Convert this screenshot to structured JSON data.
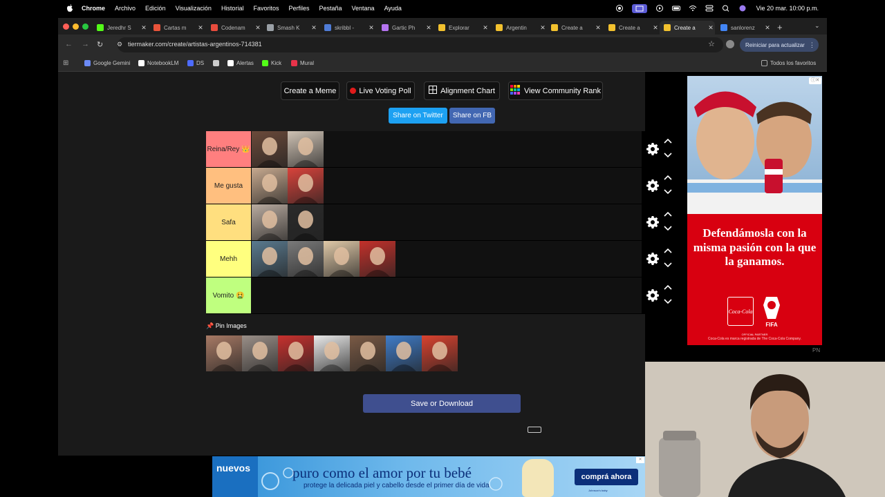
{
  "menubar": {
    "app_name": "Chrome",
    "items": [
      "Archivo",
      "Edición",
      "Visualización",
      "Historial",
      "Favoritos",
      "Perfiles",
      "Pestaña",
      "Ventana",
      "Ayuda"
    ],
    "clock": "Vie 20 mar.  10:00 p.m."
  },
  "tabs": [
    {
      "label": "Jeredhr S",
      "color": "#53fc18"
    },
    {
      "label": "Cartas m",
      "color": "#e8533a"
    },
    {
      "label": "Codenam",
      "color": "#e84c3d"
    },
    {
      "label": "Smash K",
      "color": "#9aa0a6"
    },
    {
      "label": "skribbl -",
      "color": "#4f7cd6"
    },
    {
      "label": "Gartic Ph",
      "color": "#b574f0"
    },
    {
      "label": "Explorar",
      "color": "#f2c12e"
    },
    {
      "label": "Argentin",
      "color": "#f2c12e"
    },
    {
      "label": "Create a",
      "color": "#f2c12e"
    },
    {
      "label": "Create a",
      "color": "#f2c12e"
    },
    {
      "label": "Create a",
      "color": "#f2c12e",
      "active": true
    },
    {
      "label": "sanlorenz",
      "color": "#4285f4"
    }
  ],
  "toolbar": {
    "url": "tiermaker.com/create/artistas-argentinos-714381",
    "relaunch": "Reiniciar para actualizar"
  },
  "bookmarks": {
    "items": [
      {
        "label": "Google Gemini",
        "color": "#6b8af5"
      },
      {
        "label": "NotebookLM",
        "color": "#ffffff"
      },
      {
        "label": "DS",
        "color": "#4d6bfe"
      },
      {
        "label": "",
        "color": "#cccccc"
      },
      {
        "label": "Alertas",
        "color": "#ffffff"
      },
      {
        "label": "Kick",
        "color": "#53fc18"
      },
      {
        "label": "Mural",
        "color": "#e8334a"
      }
    ],
    "all_favorites": "Todos los favoritos"
  },
  "buttons": {
    "create_meme": "Create a Meme",
    "live_poll": "Live Voting Poll",
    "alignment": "Alignment Chart",
    "community": "View Community Rank",
    "share_twitter": "Share on Twitter",
    "share_fb": "Share on FB",
    "save": "Save or Download"
  },
  "tiers": [
    {
      "label": "Reina/Rey 👑",
      "color": "#ff7f7f",
      "thumbs": [
        "#6b4a3a",
        "#cfc2b4"
      ]
    },
    {
      "label": "Me gusta",
      "color": "#ffbf7f",
      "thumbs": [
        "#c7a98f",
        "#d9433b"
      ]
    },
    {
      "label": "Safa",
      "color": "#ffdf7f",
      "thumbs": [
        "#b9aba0",
        "#2a2a2a"
      ]
    },
    {
      "label": "Mehh",
      "color": "#ffff7f",
      "thumbs": [
        "#5a7a8f",
        "#7a7a7a",
        "#e0c9a8",
        "#c3312b"
      ]
    },
    {
      "label": "Vomito 🤮",
      "color": "#bfff7f",
      "thumbs": []
    }
  ],
  "pin": {
    "label": "📌 Pin Images",
    "thumbs": [
      "#a87a65",
      "#9a8f88",
      "#c8312e",
      "#e9e9e9",
      "#7a5a45",
      "#3f7cc8",
      "#d9422f"
    ]
  },
  "ad_right": {
    "headline": "Defendámosla con la misma pasión con la que la ganamos.",
    "brand": "Coca-Cola",
    "partner": "OFFICIAL PARTNER",
    "fifa": "FIFA",
    "fine": "Coca-Cola es marca registrada de The Coca-Cola Company.",
    "badge": "PN"
  },
  "ad_bottom": {
    "badge": "nuevos",
    "headline": "puro como el amor por tu bebé",
    "sub": "protege la delicada piel y cabello desde el primer día de vida",
    "cta": "comprá ahora",
    "fine": "Johnson's baby"
  }
}
